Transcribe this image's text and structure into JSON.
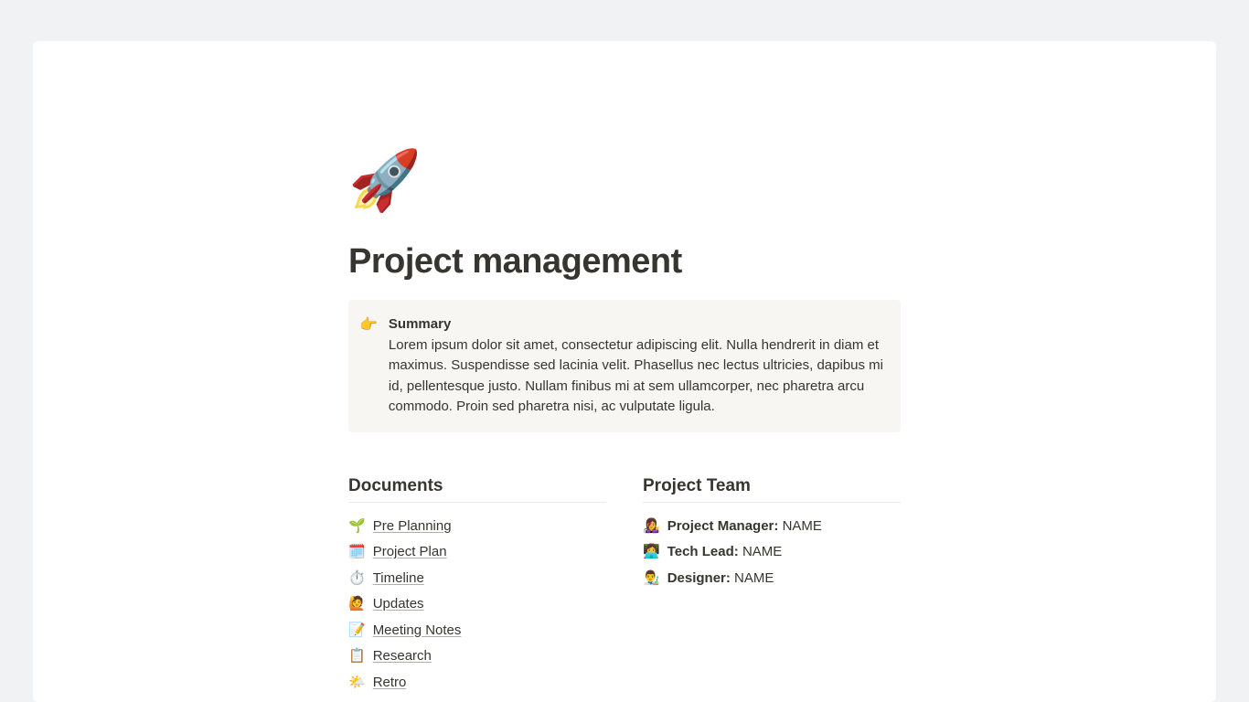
{
  "page": {
    "icon": "🚀",
    "title": "Project management"
  },
  "callout": {
    "icon": "👉",
    "title": "Summary",
    "body": "Lorem ipsum dolor sit amet, consectetur adipiscing elit. Nulla hendrerit in diam et maximus. Suspendisse sed lacinia velit. Phasellus nec lectus ultricies, dapibus mi id, pellentesque justo. Nullam finibus mi at sem ullamcorper, nec pharetra arcu commodo. Proin sed pharetra nisi, ac vulputate ligula."
  },
  "documents": {
    "heading": "Documents",
    "items": [
      {
        "icon": "🌱",
        "label": "Pre Planning"
      },
      {
        "icon": "🗓️",
        "label": "Project Plan"
      },
      {
        "icon": "⏱️",
        "label": "Timeline"
      },
      {
        "icon": "🙋",
        "label": "Updates"
      },
      {
        "icon": "📝",
        "label": "Meeting Notes"
      },
      {
        "icon": "📋",
        "label": "Research"
      },
      {
        "icon": "🌤️",
        "label": "Retro"
      }
    ]
  },
  "team": {
    "heading": "Project Team",
    "items": [
      {
        "icon": "👩‍🎤",
        "role": "Project Manager:",
        "name": "NAME"
      },
      {
        "icon": "👩‍💻",
        "role": "Tech Lead:",
        "name": "NAME"
      },
      {
        "icon": "👨‍🎨",
        "role": "Designer:",
        "name": "NAME"
      }
    ]
  }
}
